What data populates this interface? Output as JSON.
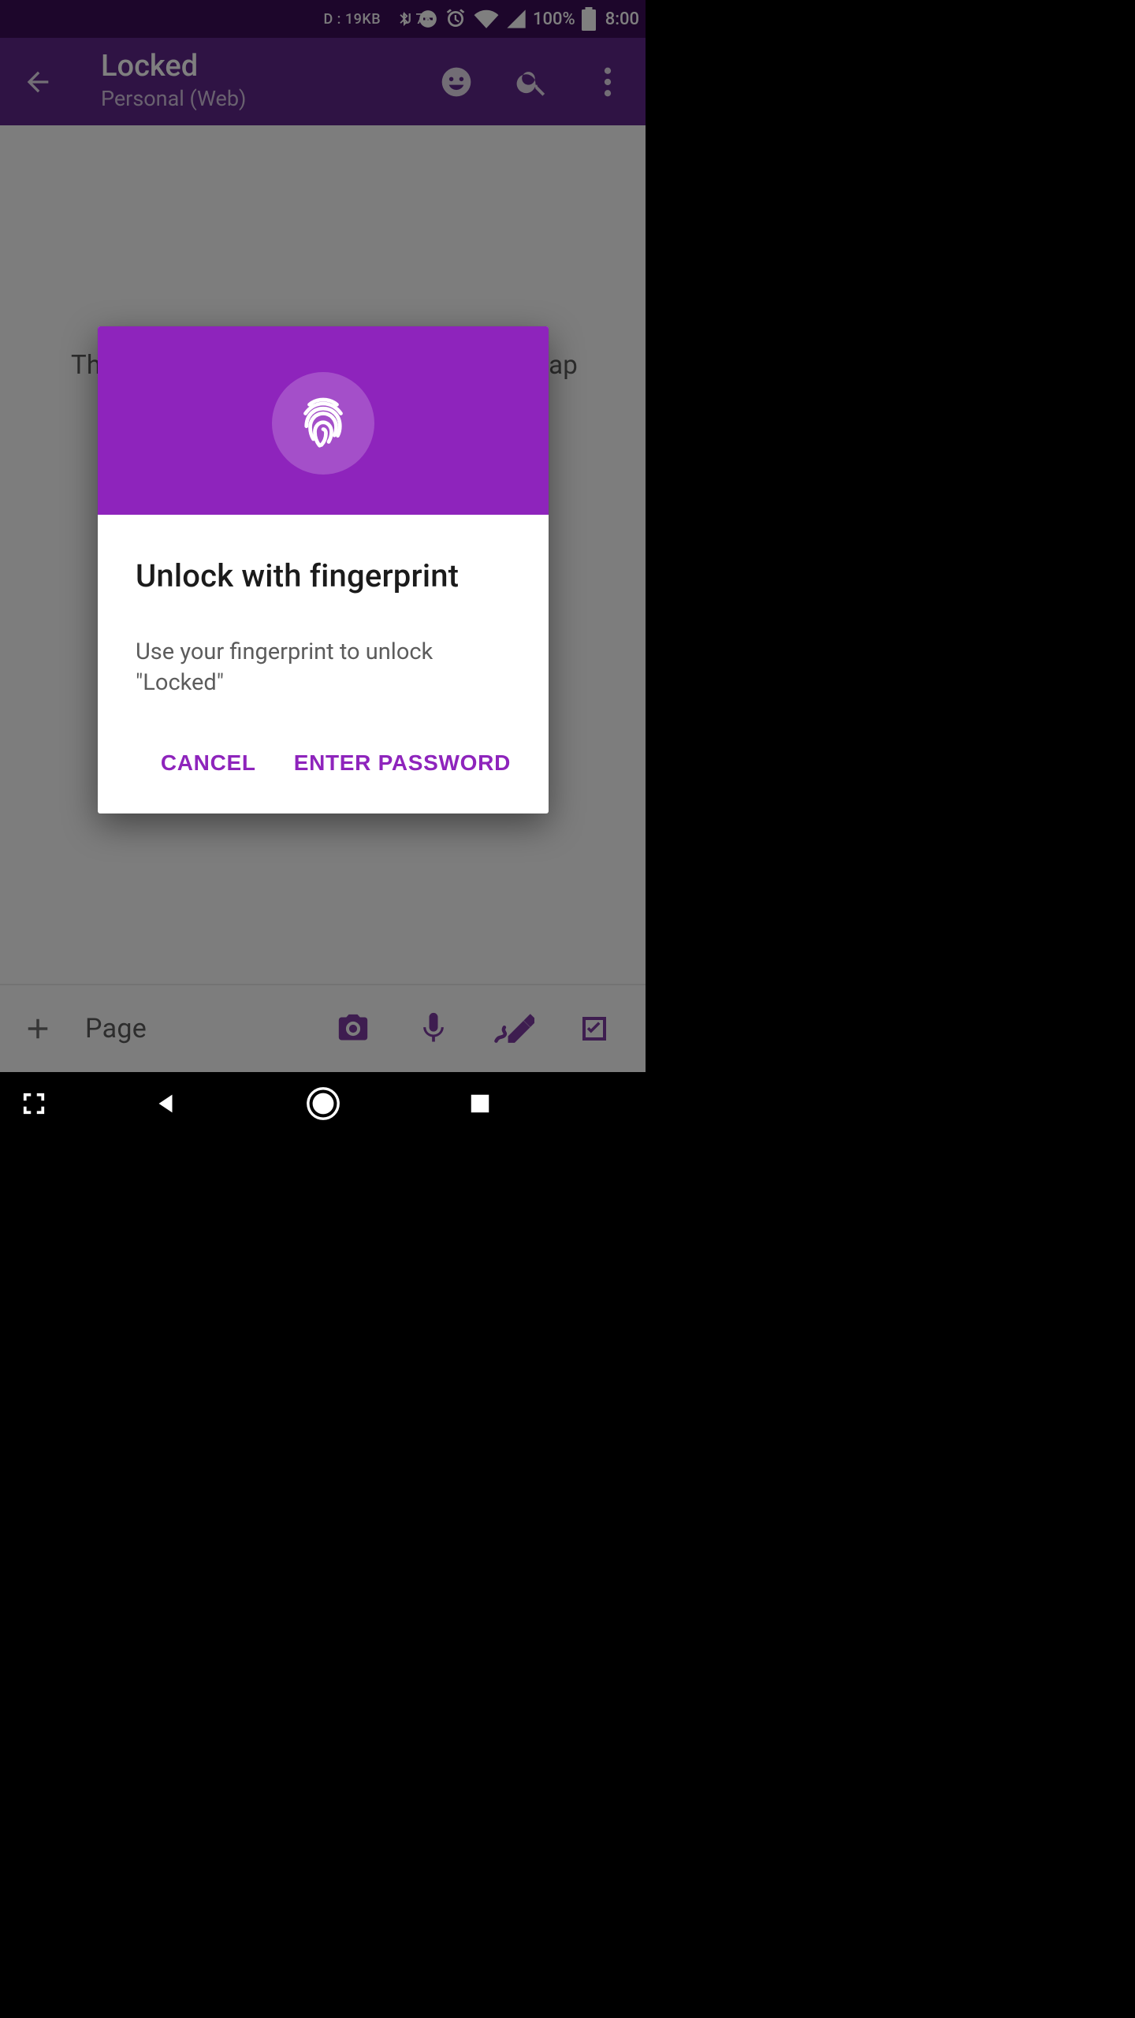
{
  "status_bar": {
    "debug_label": "D : 19KB",
    "net_label": "U  7K",
    "battery_pct": "100%",
    "time": "8:00"
  },
  "app_bar": {
    "title": "Locked",
    "subtitle": "Personal (Web)"
  },
  "content": {
    "placeholder_left": "Th",
    "placeholder_right": "ap"
  },
  "dialog": {
    "title": "Unlock with fingerprint",
    "message": "Use your fingerprint to unlock \"Locked\"",
    "cancel": "CANCEL",
    "enter_password": "ENTER PASSWORD"
  },
  "bottom_bar": {
    "page_label": "Page"
  },
  "colors": {
    "accent": "#8E24BC",
    "appbar": "#5F2789",
    "status": "#3B0D56"
  }
}
